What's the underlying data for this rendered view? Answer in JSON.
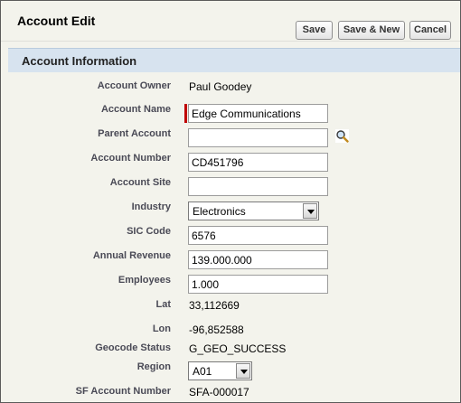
{
  "header": {
    "title": "Account Edit",
    "buttons": {
      "save": "Save",
      "save_new": "Save & New",
      "cancel": "Cancel"
    }
  },
  "section": {
    "title": "Account Information"
  },
  "fields": {
    "account_owner": {
      "label": "Account Owner",
      "value": "Paul Goodey"
    },
    "account_name": {
      "label": "Account Name",
      "value": "Edge Communications",
      "required": true
    },
    "parent_account": {
      "label": "Parent Account",
      "value": "",
      "icon": "lookup-magnifier-icon"
    },
    "account_number": {
      "label": "Account Number",
      "value": "CD451796"
    },
    "account_site": {
      "label": "Account Site",
      "value": ""
    },
    "industry": {
      "label": "Industry",
      "value": "Electronics"
    },
    "sic_code": {
      "label": "SIC Code",
      "value": "6576"
    },
    "annual_revenue": {
      "label": "Annual Revenue",
      "value": "139.000.000"
    },
    "employees": {
      "label": "Employees",
      "value": "1.000"
    },
    "lat": {
      "label": "Lat",
      "value": "33,112669"
    },
    "lon": {
      "label": "Lon",
      "value": "-96,852588"
    },
    "geocode_status": {
      "label": "Geocode Status",
      "value": "G_GEO_SUCCESS"
    },
    "region": {
      "label": "Region",
      "value": "A01"
    },
    "sf_account_number": {
      "label": "SF Account Number",
      "value": "SFA-000017"
    }
  },
  "colors": {
    "required_bar": "#c00000",
    "section_bg": "#d7e3ef",
    "page_bg": "#f3f3ec"
  }
}
